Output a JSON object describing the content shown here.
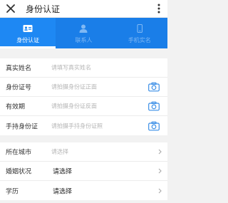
{
  "header": {
    "title": "身份认证",
    "close_icon": "close-icon",
    "more_icon": "more-vert-icon"
  },
  "tabs": [
    {
      "label": "身份认证",
      "icon": "id-card-icon",
      "active": true
    },
    {
      "label": "联系人",
      "icon": "person-icon",
      "active": false
    },
    {
      "label": "手机实名",
      "icon": "phone-icon",
      "active": false
    }
  ],
  "identity_section": [
    {
      "label": "真实姓名",
      "placeholder": "请填写真实姓名"
    },
    {
      "label": "身份证号",
      "placeholder": "请拍摄身份证正面",
      "icon": "camera-icon"
    },
    {
      "label": "有效期",
      "placeholder": "请拍摄身份证反面",
      "icon": "camera-icon"
    },
    {
      "label": "手持身份证",
      "placeholder": "请拍摄手持身份证照",
      "icon": "camera-icon"
    }
  ],
  "info_section": [
    {
      "label": "所在城市",
      "value": "请选择"
    },
    {
      "label": "婚姻状况",
      "value": "请选择"
    },
    {
      "label": "学历",
      "value": "请选择"
    }
  ],
  "colors": {
    "accent": "#1e88f3",
    "tab_bar": "#1a7ee8",
    "camera": "#3a8ee6"
  }
}
